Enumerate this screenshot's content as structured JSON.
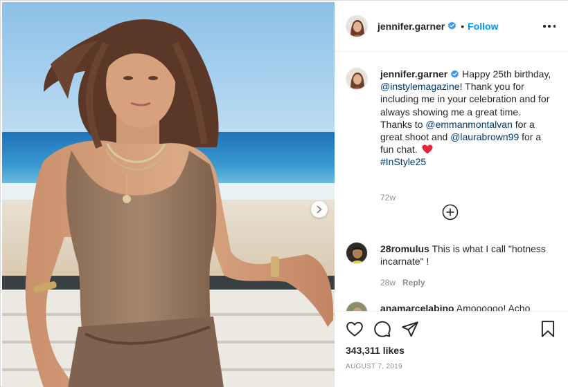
{
  "post": {
    "photo_alt": "Photo by jennifer.garner",
    "author": {
      "username": "jennifer.garner",
      "verified": true,
      "follow_label": "Follow",
      "separator": "•"
    },
    "caption": {
      "username": "jennifer.garner",
      "text_1": " Happy 25th birthday, ",
      "mention_1": "@instylemagazine",
      "text_2": "! Thank you for including me in your celebration and for always showing me a great time. Thanks to ",
      "mention_2": "@emmanmontalvan",
      "text_3": " for a great shoot and ",
      "mention_3": "@laurabrown99",
      "text_4": " for a fun chat. ",
      "emoji": "heart-emoji",
      "hashtag": "#InStyle25",
      "time": "72w"
    },
    "load_more_icon": "plus-circle-icon",
    "comments": [
      {
        "username": "28romulus",
        "text": " This is what I call \"hotness incarnate\" !",
        "time": "28w",
        "reply_label": "Reply"
      },
      {
        "username": "anamarcelabino",
        "text": " Amoooooo! Acho"
      }
    ],
    "actions": {
      "icons": [
        "heart-icon",
        "comment-icon",
        "share-icon",
        "bookmark-icon"
      ],
      "likes": "343,311 likes",
      "date": "AUGUST 7, 2019"
    }
  },
  "colors": {
    "link": "#00376b",
    "follow": "#0095f6",
    "verified": "#3897f0",
    "muted": "#8e8e8e",
    "text": "#262626",
    "heart_emoji": "#e0283a"
  }
}
